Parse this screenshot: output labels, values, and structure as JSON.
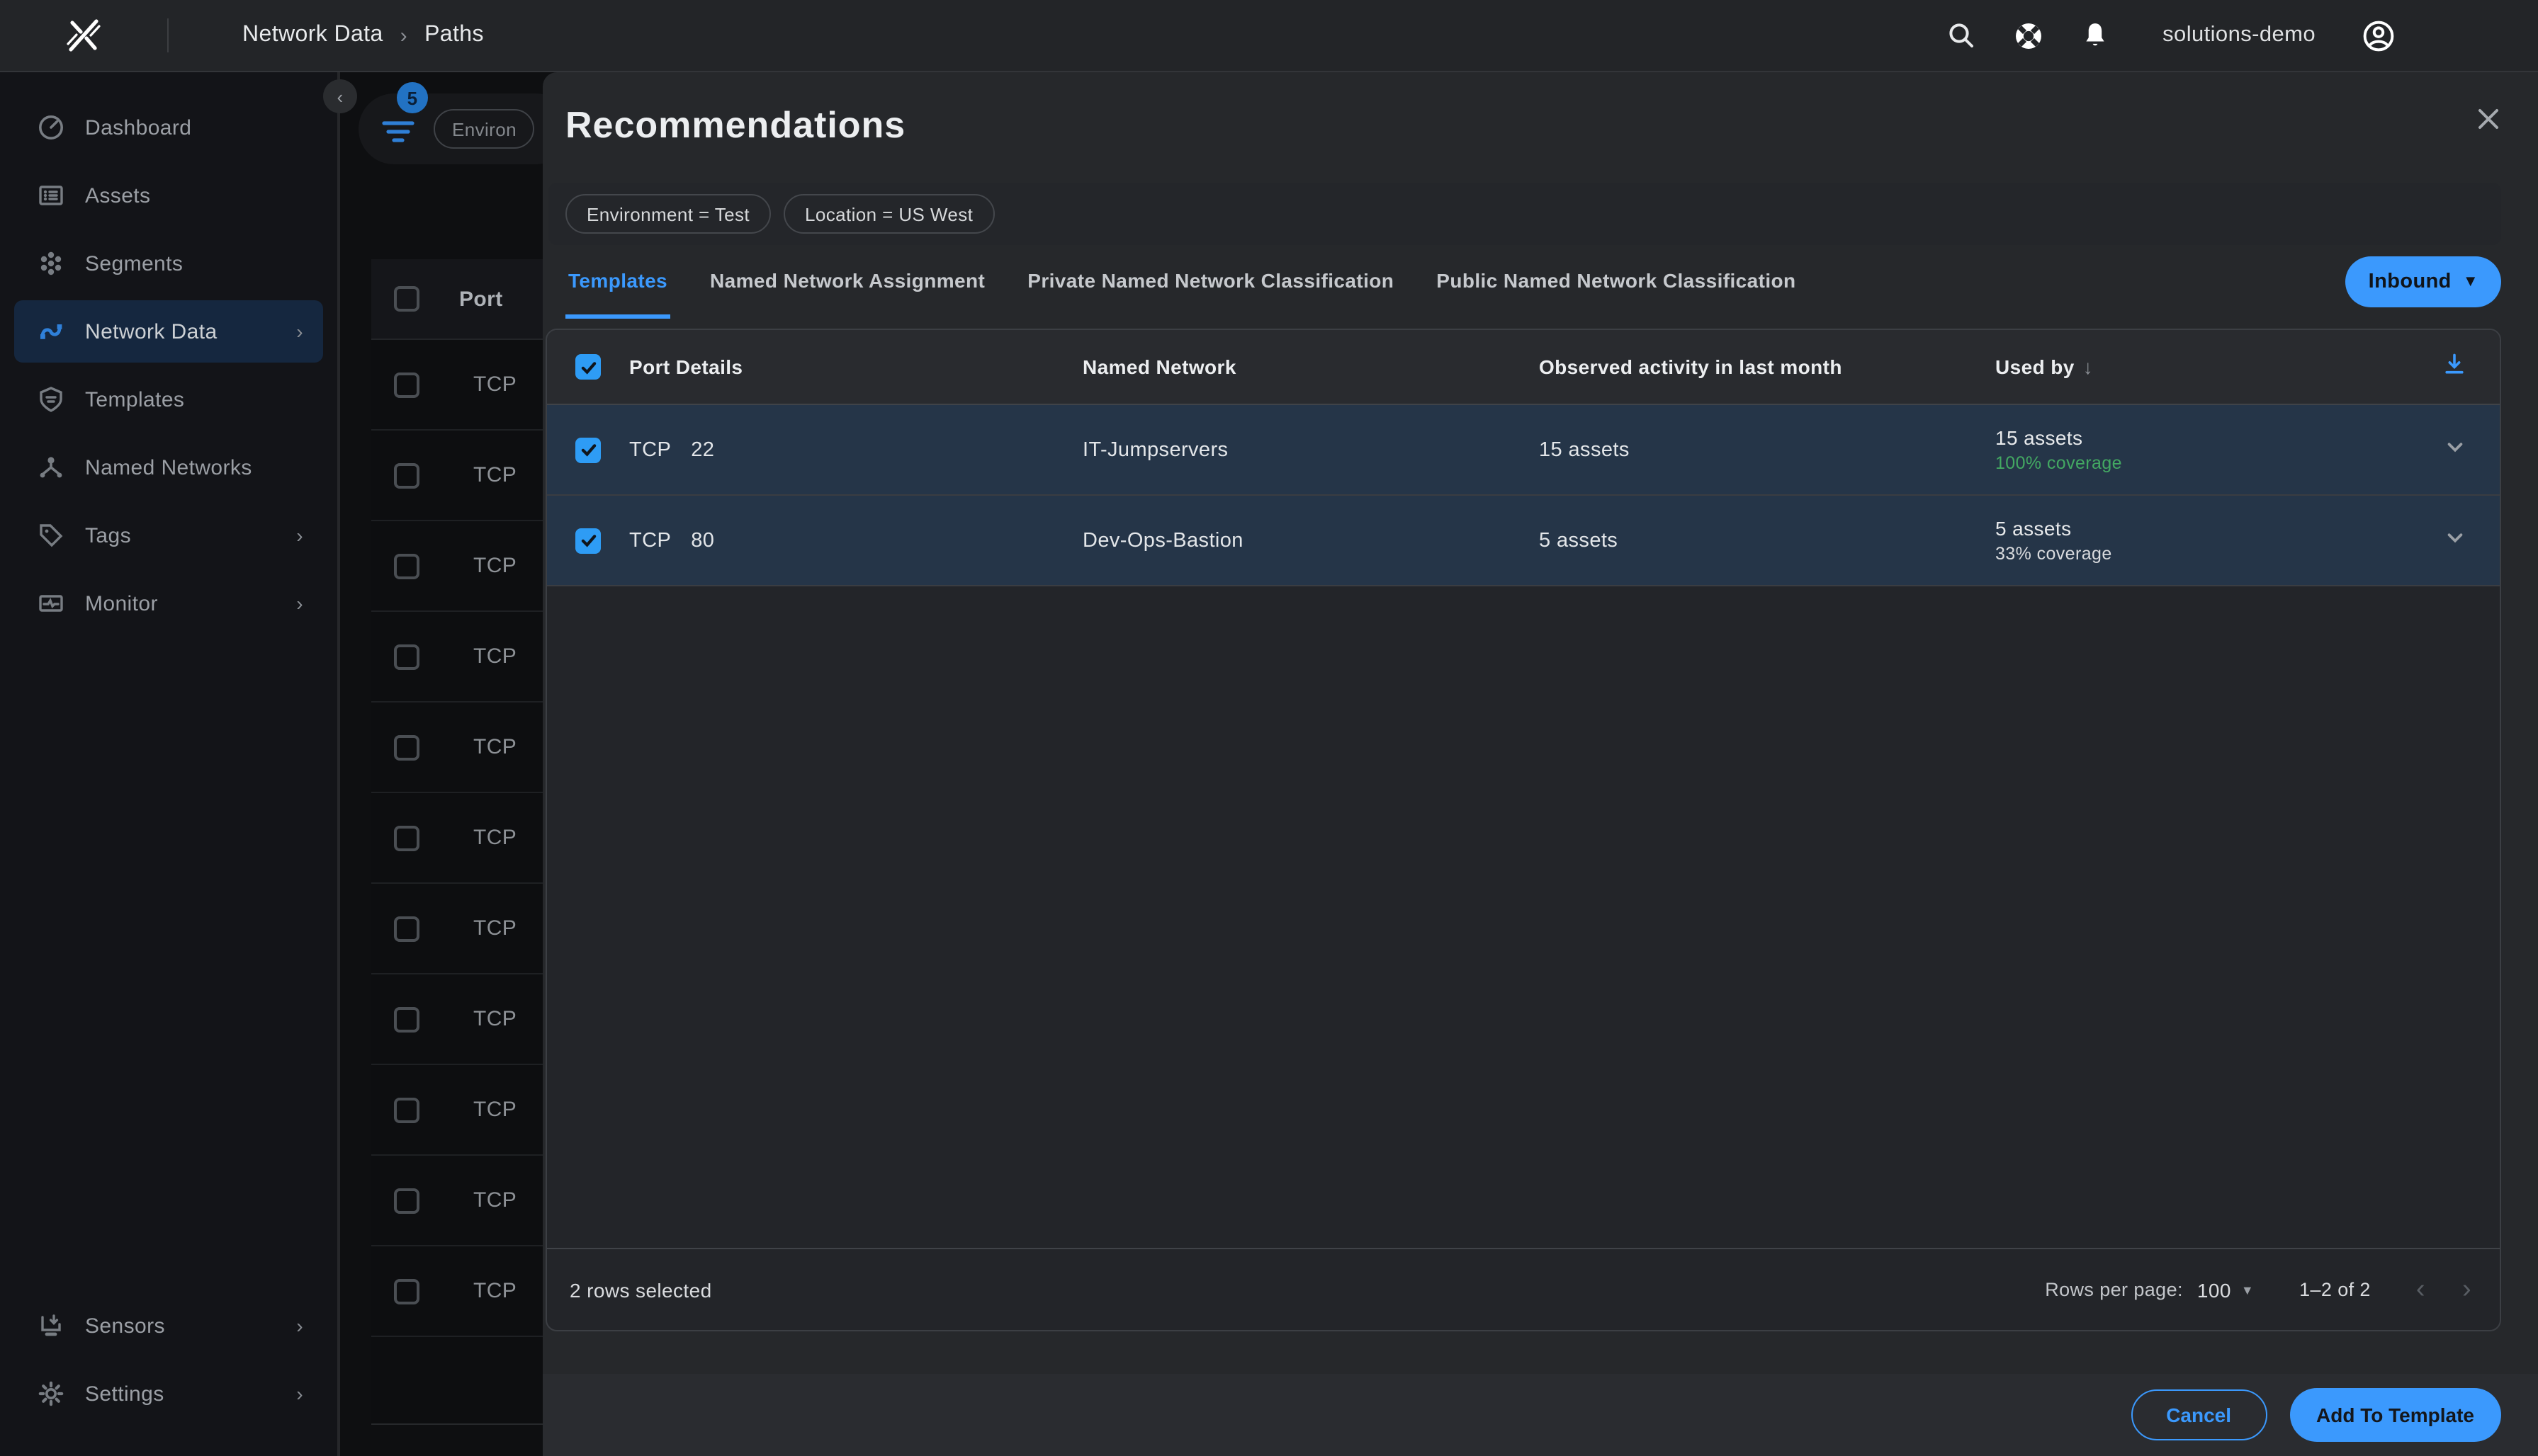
{
  "topbar": {
    "breadcrumb": {
      "parent": "Network Data",
      "separator": "›",
      "current": "Paths"
    },
    "username": "solutions-demo",
    "icons": [
      "search-icon",
      "help-ring-icon",
      "notifications-bell-icon",
      "account-avatar-icon"
    ]
  },
  "sidebar": {
    "collapse_icon": "chevron-left",
    "items": [
      {
        "label": "Dashboard",
        "icon": "dashboard-gauge-icon",
        "chevron": false,
        "active": false
      },
      {
        "label": "Assets",
        "icon": "assets-list-icon",
        "chevron": false,
        "active": false
      },
      {
        "label": "Segments",
        "icon": "segments-cluster-icon",
        "chevron": false,
        "active": false
      },
      {
        "label": "Network Data",
        "icon": "network-route-icon",
        "chevron": true,
        "active": true
      },
      {
        "label": "Templates",
        "icon": "shield-icon",
        "chevron": false,
        "active": false
      },
      {
        "label": "Named Networks",
        "icon": "network-nodes-icon",
        "chevron": false,
        "active": false
      },
      {
        "label": "Tags",
        "icon": "tag-icon",
        "chevron": true,
        "active": false
      },
      {
        "label": "Monitor",
        "icon": "monitor-chart-icon",
        "chevron": true,
        "active": false
      },
      {
        "label": "Sensors",
        "icon": "sensor-download-icon",
        "chevron": true,
        "active": false
      },
      {
        "label": "Settings",
        "icon": "gear-icon",
        "chevron": true,
        "active": false
      }
    ]
  },
  "background": {
    "filter_badge_count": "5",
    "filter_chip": "Environ",
    "table": {
      "column": "Port",
      "row_protocol": "TCP",
      "row_count": 11
    }
  },
  "modal": {
    "title": "Recommendations",
    "filters": [
      "Environment = Test",
      "Location = US West"
    ],
    "tabs": [
      {
        "label": "Templates",
        "active": true
      },
      {
        "label": "Named Network Assignment",
        "active": false
      },
      {
        "label": "Private Named Network Classification",
        "active": false
      },
      {
        "label": "Public Named Network Classification",
        "active": false
      }
    ],
    "direction_button": {
      "label": "Inbound"
    },
    "table": {
      "columns": {
        "port": "Port Details",
        "named_network": "Named Network",
        "observed": "Observed activity in last month",
        "used_by": "Used by"
      },
      "sort_indicator": "↓",
      "rows": [
        {
          "selected": true,
          "protocol": "TCP",
          "port": "22",
          "named_network": "IT-Jumpservers",
          "observed": "15 assets",
          "used_by": "15 assets",
          "coverage": "100% coverage",
          "coverage_color": "#43a862"
        },
        {
          "selected": true,
          "protocol": "TCP",
          "port": "80",
          "named_network": "Dev-Ops-Bastion",
          "observed": "5 assets",
          "used_by": "5 assets",
          "coverage": "33% coverage",
          "coverage_color": "#d9dbde"
        }
      ],
      "footer": {
        "selection": "2 rows selected",
        "rows_per_page_label": "Rows per page:",
        "rows_per_page": "100",
        "range": "1–2 of 2"
      }
    },
    "actions": {
      "cancel": "Cancel",
      "submit": "Add To Template"
    }
  },
  "colors": {
    "accent_blue": "#3b99fd",
    "checkbox_blue": "#2e9cf5",
    "coverage_green": "#43a862",
    "row_blue": "#253548",
    "modal_bg": "#26282b"
  }
}
